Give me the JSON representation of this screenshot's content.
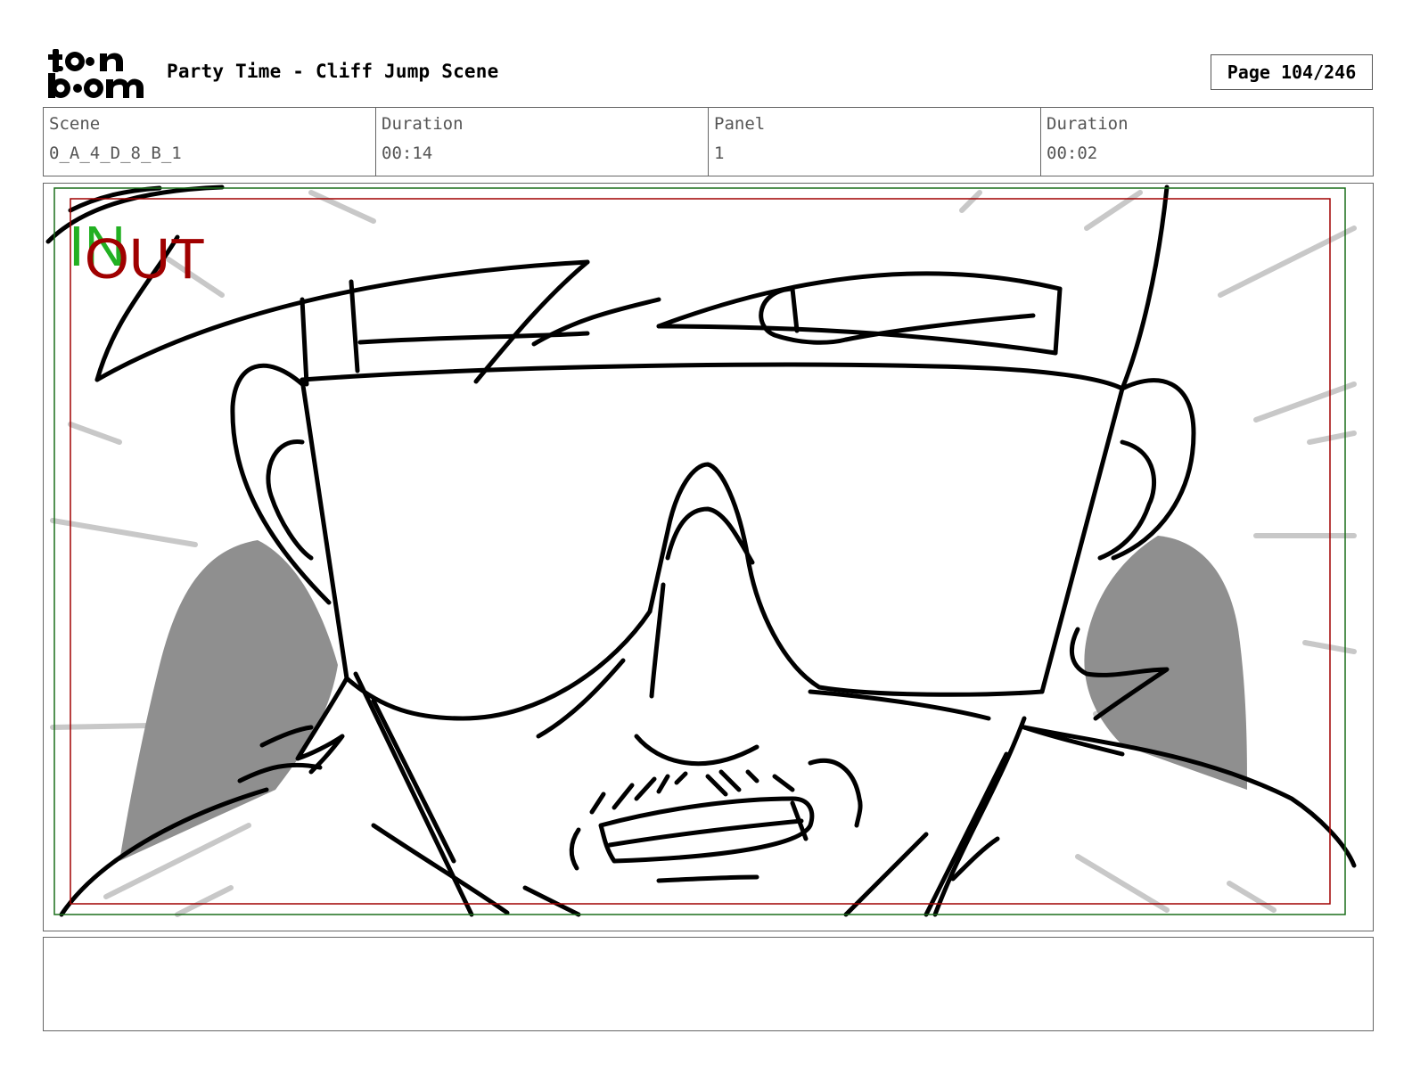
{
  "header": {
    "title": "Party Time - Cliff Jump Scene",
    "page": "Page 104/246"
  },
  "logo": {
    "top": "toon",
    "bottom": "boom"
  },
  "info": [
    {
      "label": "Scene",
      "value": "0_A_4_D_8_B_1"
    },
    {
      "label": "Duration",
      "value": "00:14"
    },
    {
      "label": "Panel",
      "value": "1"
    },
    {
      "label": "Duration",
      "value": "00:02"
    }
  ],
  "panel": {
    "in_marker": "IN",
    "out_marker": "OUT",
    "colors": {
      "in": "#22b022",
      "out": "#a00000",
      "title_safe": "#a00000",
      "action_safe": "#1a6e1a",
      "shading": "#8f8f8f"
    },
    "description": "Close-up sketch of a grinning character wearing large sunglasses and a headband, with motion speed lines"
  },
  "notes": {
    "text": ""
  }
}
